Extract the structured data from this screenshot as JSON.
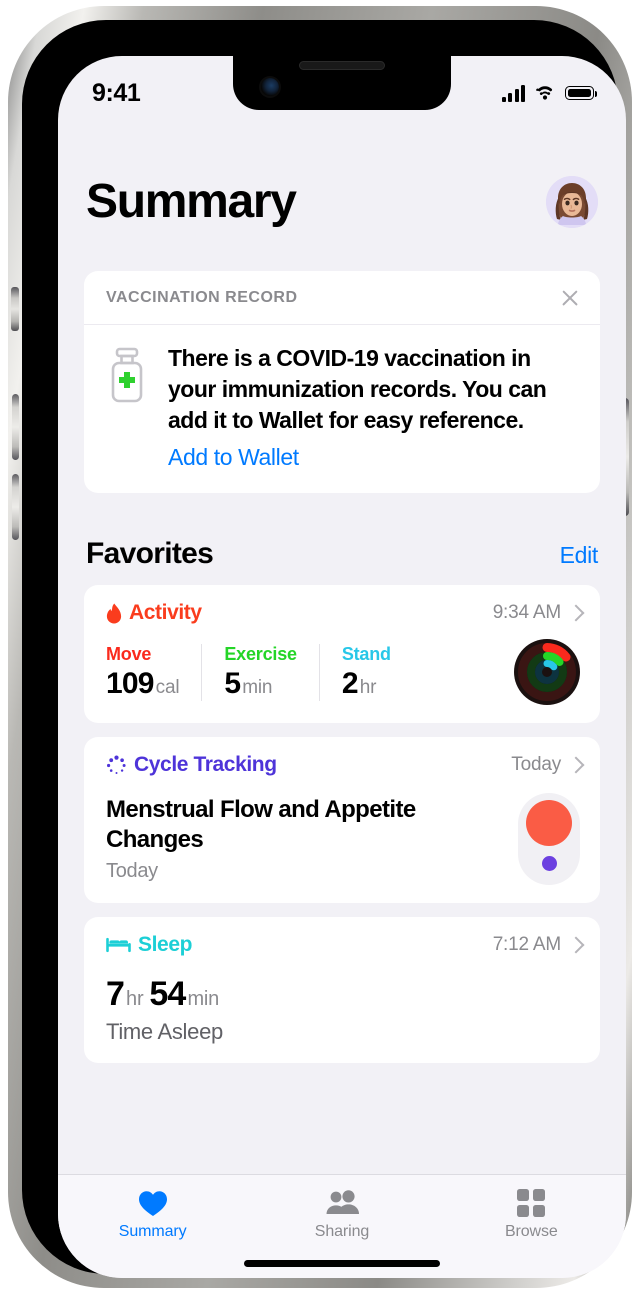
{
  "device": {
    "frame": "iphone",
    "accent_blue": "#007aff",
    "screen_bg": "#f2f1f6",
    "card_bg": "#ffffff"
  },
  "status_bar": {
    "time": "9:41",
    "cellular_icon": "cellular-bars-icon",
    "wifi_icon": "wifi-icon",
    "battery_icon": "battery-full-icon"
  },
  "header": {
    "title": "Summary",
    "avatar_name": "memoji-avatar"
  },
  "vaccination_card": {
    "header_label": "VACCINATION RECORD",
    "close_icon": "close-icon",
    "vial_icon": "vaccine-vial-icon",
    "body_text": "There is a COVID-19 vaccination in your immunization records. You can add it to Wallet for easy reference.",
    "action_label": "Add to Wallet",
    "action_color": "#007aff"
  },
  "favorites": {
    "section_title": "Favorites",
    "edit_label": "Edit",
    "cards": [
      {
        "name": "Activity",
        "icon": "flame-icon",
        "color": "#fa3c1d",
        "timestamp": "9:34 AM",
        "metrics": [
          {
            "label": "Move",
            "label_color": "#fa2a1d",
            "value": "109",
            "unit": "cal"
          },
          {
            "label": "Exercise",
            "label_color": "#24d527",
            "value": "5",
            "unit": "min"
          },
          {
            "label": "Stand",
            "label_color": "#28c7e8",
            "value": "2",
            "unit": "hr"
          }
        ],
        "rings": {
          "move_color": "#fa2a1d",
          "exercise_color": "#24d527",
          "stand_color": "#28c7e8",
          "background": "#1b1110"
        }
      },
      {
        "name": "Cycle Tracking",
        "icon": "cycle-dots-icon",
        "color": "#4e34d9",
        "timestamp": "Today",
        "title": "Menstrual Flow and Appetite Changes",
        "subtitle": "Today",
        "graphic": {
          "flow_dot_color": "#fa5c45",
          "symptom_dot_color": "#6c40e0"
        }
      },
      {
        "name": "Sleep",
        "icon": "bed-icon",
        "color": "#1ccfd6",
        "timestamp": "7:12 AM",
        "hours_value": "7",
        "hours_unit": "hr",
        "minutes_value": "54",
        "minutes_unit": "min",
        "subtitle": "Time Asleep"
      }
    ]
  },
  "tab_bar": {
    "items": [
      {
        "label": "Summary",
        "icon": "heart-icon",
        "active": true
      },
      {
        "label": "Sharing",
        "icon": "people-icon",
        "active": false
      },
      {
        "label": "Browse",
        "icon": "grid-icon",
        "active": false
      }
    ]
  }
}
